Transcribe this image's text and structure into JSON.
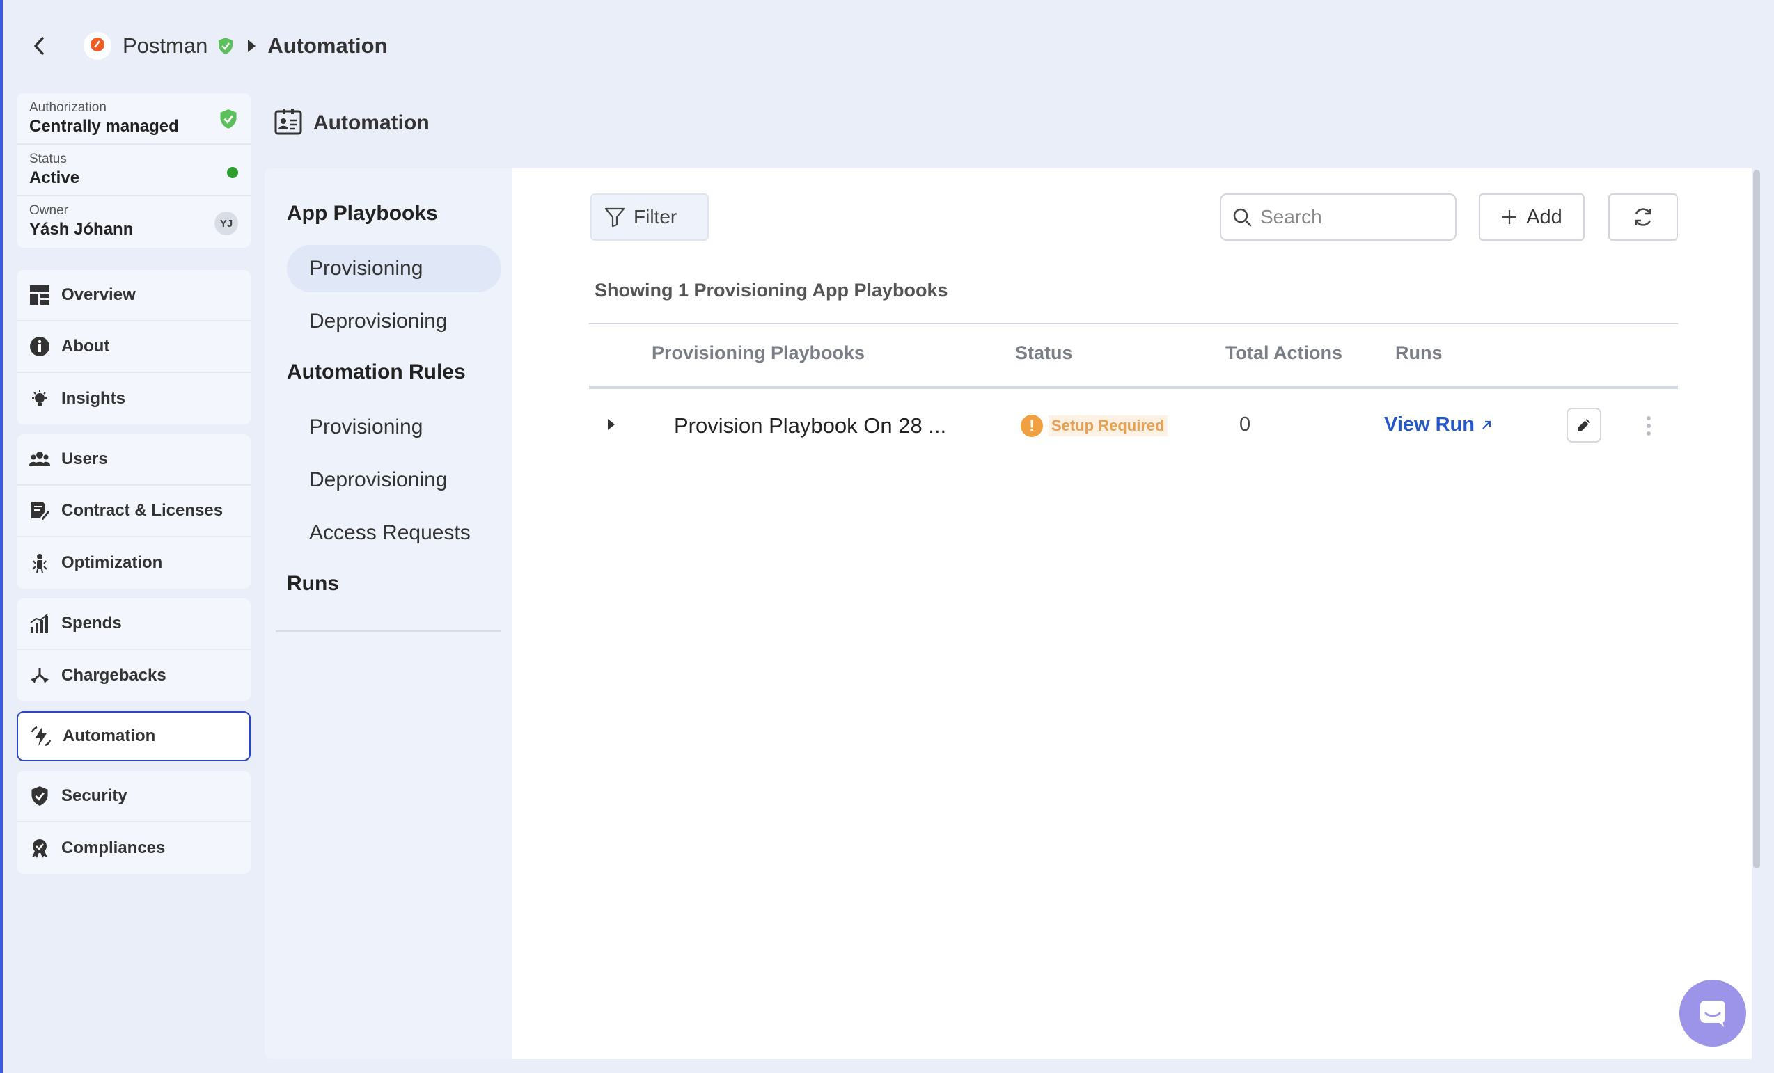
{
  "breadcrumb": {
    "app": "Postman",
    "current": "Automation"
  },
  "info": {
    "authorization_label": "Authorization",
    "authorization_value": "Centrally managed",
    "status_label": "Status",
    "status_value": "Active",
    "owner_label": "Owner",
    "owner_value": "Yásh Jóhann",
    "owner_initials": "YJ"
  },
  "nav": {
    "overview": "Overview",
    "about": "About",
    "insights": "Insights",
    "users": "Users",
    "contracts": "Contract & Licenses",
    "optimization": "Optimization",
    "spends": "Spends",
    "chargebacks": "Chargebacks",
    "automation": "Automation",
    "security": "Security",
    "compliances": "Compliances"
  },
  "section_title": "Automation",
  "subnav": {
    "app_playbooks": "App Playbooks",
    "pb_provisioning": "Provisioning",
    "pb_deprovisioning": "Deprovisioning",
    "automation_rules": "Automation Rules",
    "rules_provisioning": "Provisioning",
    "rules_deprovisioning": "Deprovisioning",
    "access_requests": "Access Requests",
    "runs": "Runs"
  },
  "toolbar": {
    "filter_label": "Filter",
    "search_placeholder": "Search",
    "add_label": "Add"
  },
  "showing_text": "Showing 1 Provisioning App Playbooks",
  "table": {
    "headers": [
      "Provisioning Playbooks",
      "Status",
      "Total Actions",
      "Runs"
    ],
    "rows": [
      {
        "name": "Provision Playbook On 28 ...",
        "status": "Setup Required",
        "total_actions": "0",
        "runs_link": "View Run"
      }
    ]
  },
  "colors": {
    "accent": "#2846c7",
    "link": "#2457c9",
    "warning": "#f0a040",
    "success": "#2e9e2e"
  }
}
